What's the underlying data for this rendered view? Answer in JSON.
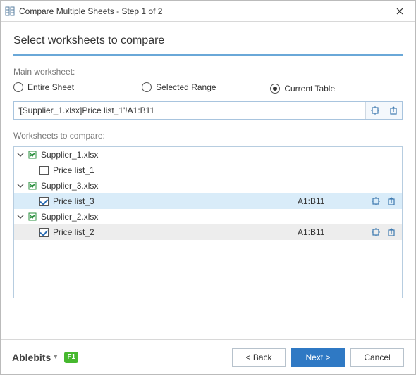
{
  "window": {
    "title": "Compare Multiple Sheets - Step 1 of 2"
  },
  "heading": "Select worksheets to compare",
  "main_ws_label": "Main worksheet:",
  "radios": {
    "entire": "Entire Sheet",
    "selected": "Selected Range",
    "current": "Current Table"
  },
  "range_value": "'[Supplier_1.xlsx]Price list_1'!A1:B11",
  "compare_label": "Worksheets to compare:",
  "tree": {
    "wb1": "Supplier_1.xlsx",
    "ws1": "Price list_1",
    "wb2": "Supplier_3.xlsx",
    "ws2": "Price list_3",
    "ws2_range": "A1:B11",
    "wb3": "Supplier_2.xlsx",
    "ws3": "Price list_2",
    "ws3_range": "A1:B11"
  },
  "footer": {
    "brand": "Ablebits",
    "f1": "F1",
    "back": "< Back",
    "next": "Next >",
    "cancel": "Cancel"
  }
}
